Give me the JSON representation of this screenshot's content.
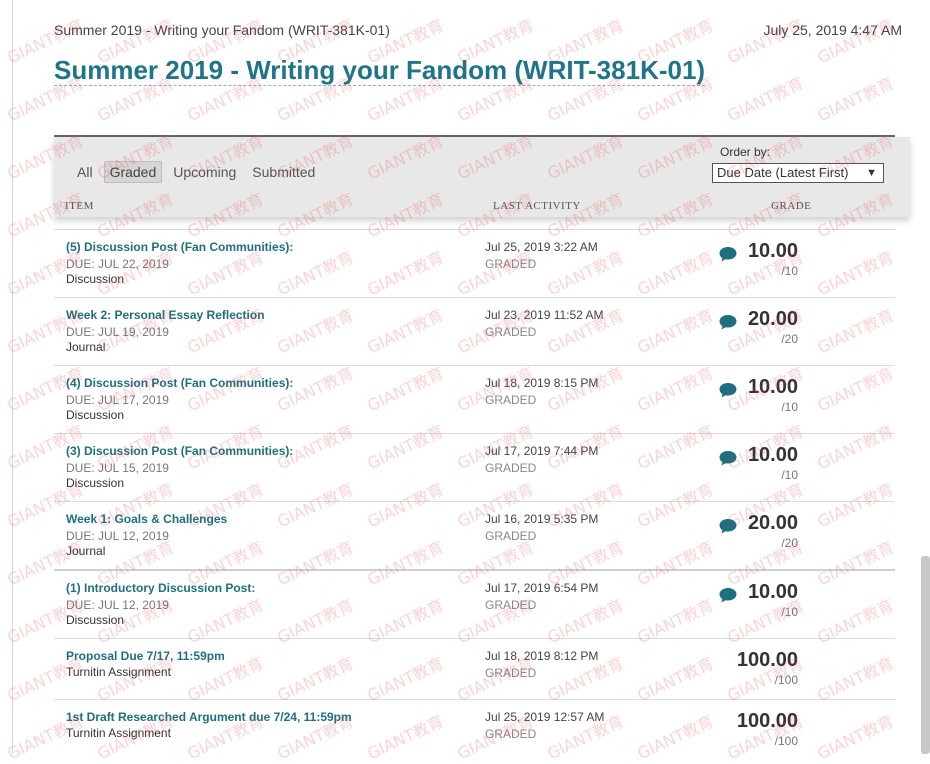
{
  "header": {
    "course_short": "Summer 2019 - Writing your Fandom (WRIT-381K-01)",
    "datetime": "July 25, 2019 4:47 AM",
    "title": "Summer 2019 - Writing your Fandom (WRIT-381K-01)"
  },
  "filters": {
    "all": "All",
    "graded": "Graded",
    "upcoming": "Upcoming",
    "submitted": "Submitted",
    "active": "Graded"
  },
  "order": {
    "label": "Order by:",
    "selected": "Due Date (Latest First)"
  },
  "columns": {
    "item": "ITEM",
    "last_activity": "LAST ACTIVITY",
    "grade": "GRADE"
  },
  "rows": [
    {
      "name": "(5) Discussion Post (Fan Communities):",
      "due": "DUE: JUL 22, 2019",
      "type": "Discussion",
      "activity": "Jul 25, 2019 3:22 AM",
      "status": "GRADED",
      "comment": true,
      "score": "10.00",
      "outof": "/10"
    },
    {
      "name": "Week 2: Personal Essay Reflection",
      "due": "DUE: JUL 19, 2019",
      "type": "Journal",
      "activity": "Jul 23, 2019 11:52 AM",
      "status": "GRADED",
      "comment": true,
      "score": "20.00",
      "outof": "/20"
    },
    {
      "name": "(4) Discussion Post (Fan Communities):",
      "due": "DUE: JUL 17, 2019",
      "type": "Discussion",
      "activity": "Jul 18, 2019 8:15 PM",
      "status": "GRADED",
      "comment": true,
      "score": "10.00",
      "outof": "/10"
    },
    {
      "name": "(3) Discussion Post (Fan Communities):",
      "due": "DUE: JUL 15, 2019",
      "type": "Discussion",
      "activity": "Jul 17, 2019 7:44 PM",
      "status": "GRADED",
      "comment": true,
      "score": "10.00",
      "outof": "/10"
    },
    {
      "name": "Week 1: Goals & Challenges",
      "due": "DUE: JUL 12, 2019",
      "type": "Journal",
      "activity": "Jul 16, 2019 5:35 PM",
      "status": "GRADED",
      "comment": true,
      "score": "20.00",
      "outof": "/20"
    },
    {
      "name": "(1) Introductory Discussion Post:",
      "due": "DUE: JUL 12, 2019",
      "type": "Discussion",
      "activity": "Jul 17, 2019 6:54 PM",
      "status": "GRADED",
      "comment": true,
      "score": "10.00",
      "outof": "/10"
    },
    {
      "name": "Proposal Due 7/17, 11:59pm",
      "due": "",
      "type": "Turnitin Assignment",
      "activity": "Jul 18, 2019 8:12 PM",
      "status": "GRADED",
      "comment": false,
      "score": "100.00",
      "outof": "/100"
    },
    {
      "name": "1st Draft Researched Argument due 7/24, 11:59pm",
      "due": "",
      "type": "Turnitin Assignment",
      "activity": "Jul 25, 2019 12:57 AM",
      "status": "GRADED",
      "comment": false,
      "score": "100.00",
      "outof": "/100"
    }
  ],
  "watermark": "GIANT教育",
  "colors": {
    "accent": "#1e7489",
    "comment_icon": "#1e6f80"
  }
}
